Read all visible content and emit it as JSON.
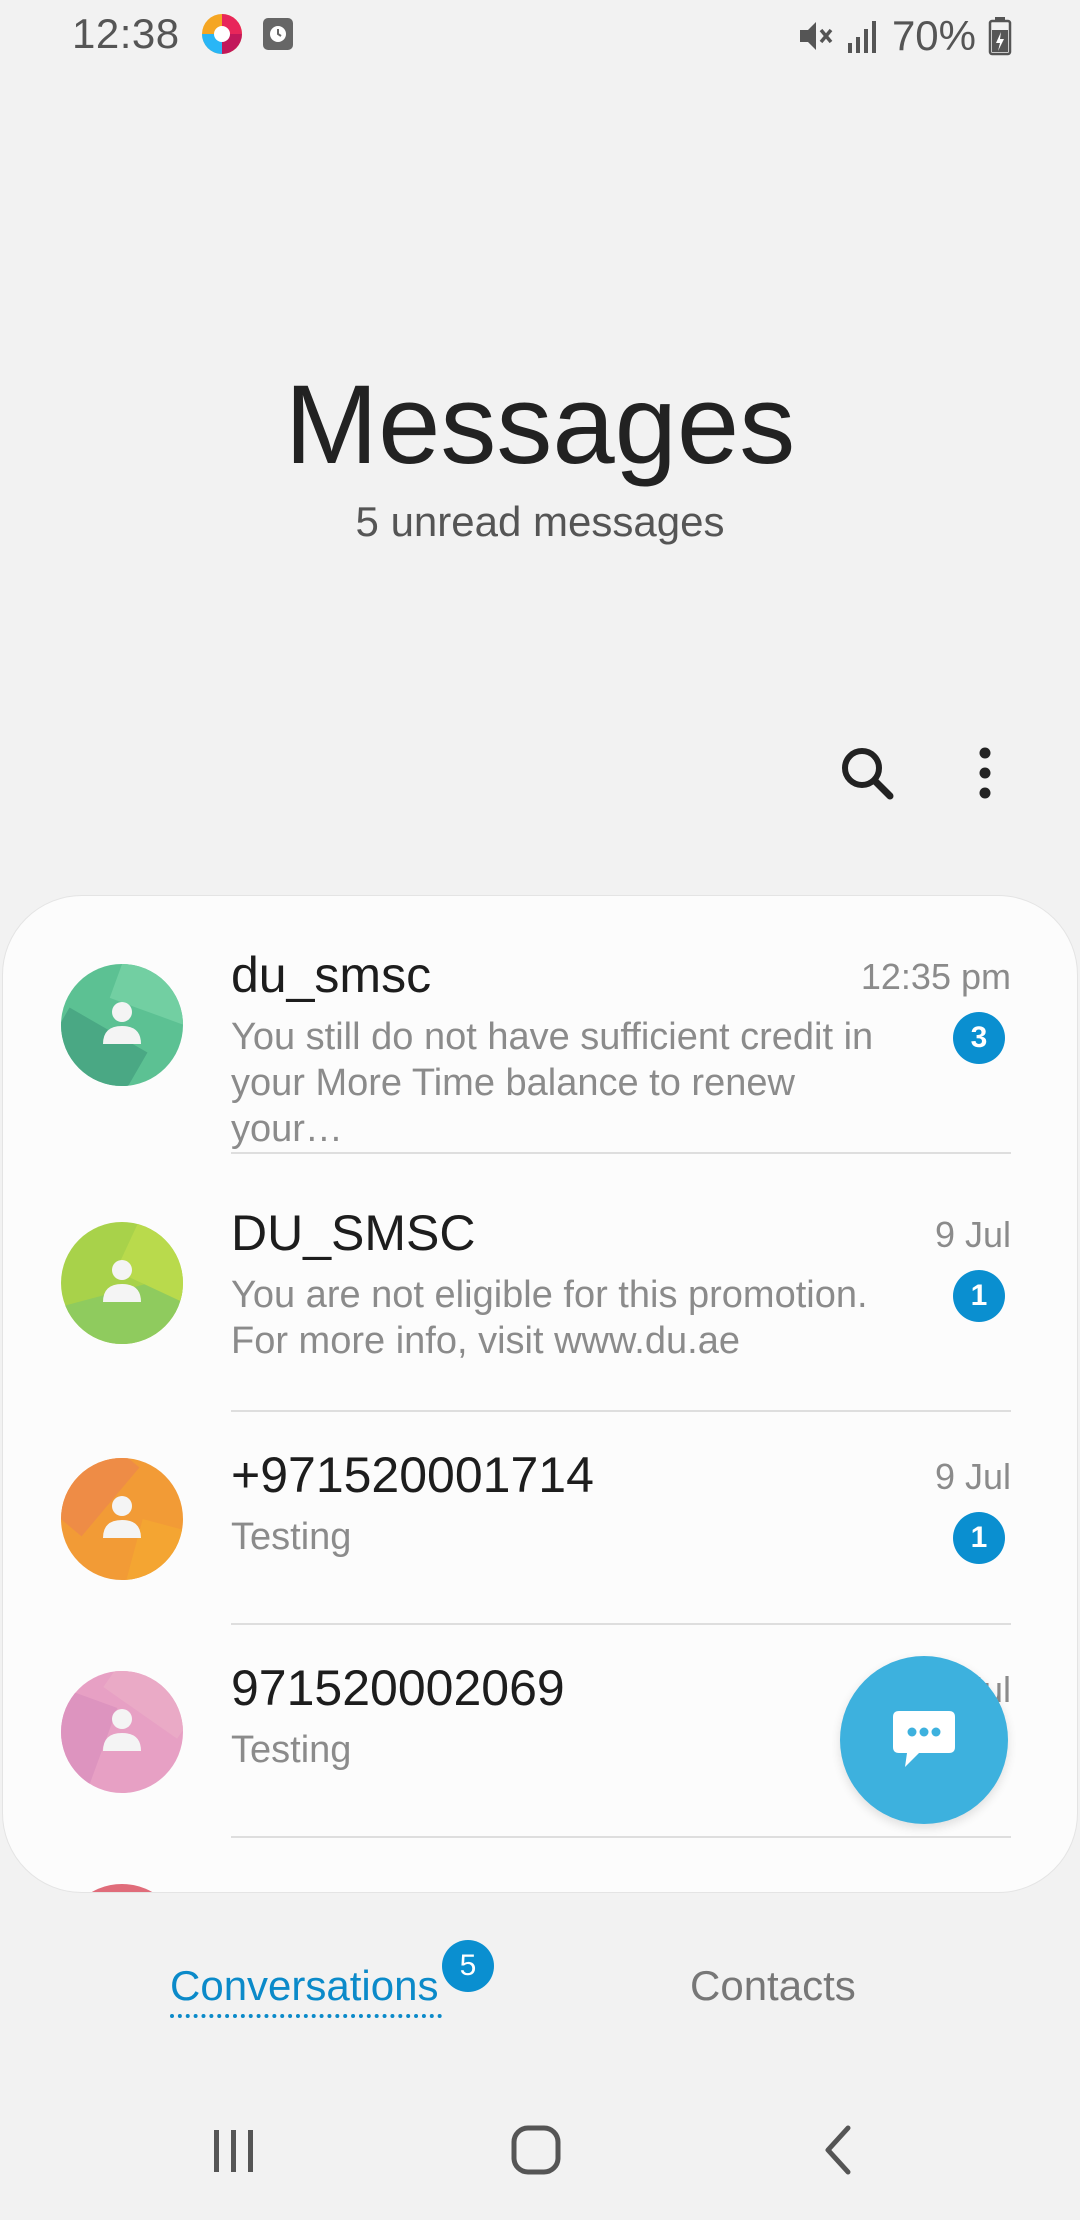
{
  "status_bar": {
    "time": "12:38",
    "battery": "70%",
    "icons": [
      "colorful-app-icon",
      "clock-icon",
      "mute-icon",
      "signal-icon",
      "battery-charging-icon"
    ]
  },
  "header": {
    "title": "Messages",
    "subtitle": "5 unread messages"
  },
  "toolbar": {
    "icons": [
      "search-icon",
      "more-options-icon"
    ]
  },
  "conversations": [
    {
      "name": "du_smsc",
      "time": "12:35 pm",
      "preview": "You still do not have sufficient credit in your More Time balance to renew your…",
      "unread": "3",
      "avatar_color": "#5cc193"
    },
    {
      "name": "DU_SMSC",
      "time": "9 Jul",
      "preview": "You are not eligible for this promotion. For more info, visit www.du.ae",
      "unread": "1",
      "avatar_color": "#a8d24a"
    },
    {
      "name": "+971520001714",
      "time": "9 Jul",
      "preview": "Testing",
      "unread": "1",
      "avatar_color": "#f29b36"
    },
    {
      "name": "971520002069",
      "time": "9 Jul",
      "preview": "Testing",
      "unread": "",
      "avatar_color": "#e7a0c4"
    }
  ],
  "fab": {
    "icon": "new-message-icon"
  },
  "tabs": {
    "conversations_label": "Conversations",
    "conversations_badge": "5",
    "contacts_label": "Contacts"
  },
  "nav_bar": {
    "icons": [
      "recents-icon",
      "home-icon",
      "back-icon"
    ]
  },
  "colors": {
    "accent": "#0a8fd0",
    "fab": "#3db1de",
    "background": "#f2f2f2"
  }
}
